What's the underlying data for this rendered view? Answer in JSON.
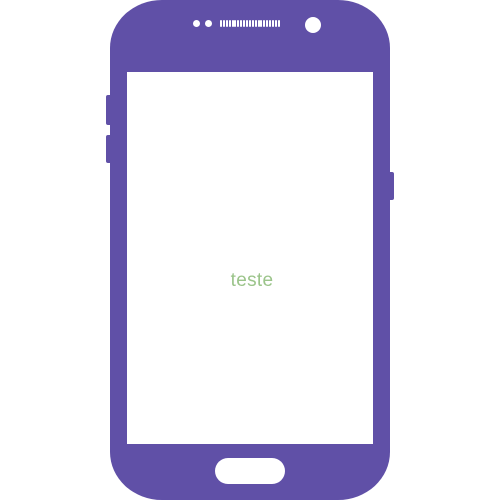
{
  "screen": {
    "text": "teste"
  },
  "colors": {
    "phone_body": "#6050a7",
    "screen_background": "#ffffff",
    "screen_text": "#9bc48a"
  },
  "icons": {
    "device": "smartphone-icon",
    "camera": "front-camera-icon",
    "speaker": "speaker-grille-icon",
    "home": "home-button-icon"
  }
}
